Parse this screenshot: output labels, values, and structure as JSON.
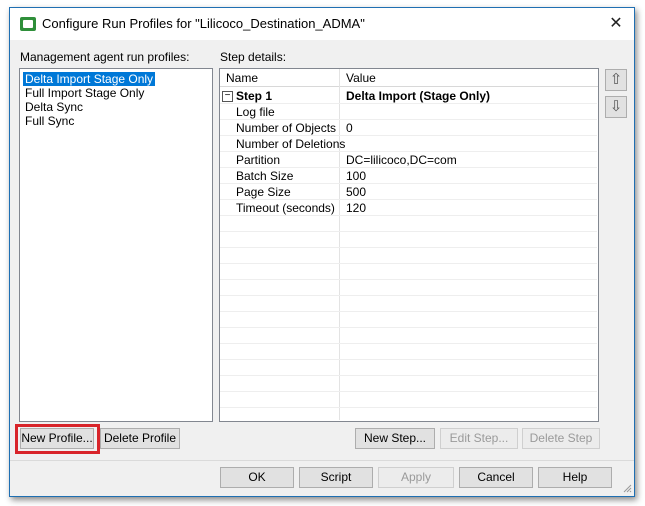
{
  "window": {
    "title": "Configure Run Profiles for \"Lilicoco_Destination_ADMA\"",
    "close_glyph": "✕"
  },
  "profiles": {
    "label": "Management agent run profiles:",
    "items": [
      {
        "label": "Delta Import Stage Only",
        "selected": true
      },
      {
        "label": "Full Import Stage Only",
        "selected": false
      },
      {
        "label": "Delta Sync",
        "selected": false
      },
      {
        "label": "Full Sync",
        "selected": false
      }
    ],
    "new_button": "New Profile...",
    "delete_button": "Delete Profile"
  },
  "step_details": {
    "label": "Step details:",
    "columns": [
      "Name",
      "Value"
    ],
    "collapse_glyph": "−",
    "step": {
      "name": "Step 1",
      "value": "Delta Import (Stage Only)"
    },
    "rows": [
      {
        "name": "Log file",
        "value": ""
      },
      {
        "name": "Number of Objects",
        "value": "0"
      },
      {
        "name": "Number of Deletions",
        "value": ""
      },
      {
        "name": "Partition",
        "value": "DC=lilicoco,DC=com"
      },
      {
        "name": "Batch Size",
        "value": "100"
      },
      {
        "name": "Page Size",
        "value": "500"
      },
      {
        "name": "Timeout (seconds)",
        "value": "120"
      }
    ],
    "up_glyph": "⇧",
    "down_glyph": "⇩",
    "new_step_button": "New Step...",
    "edit_step_button": "Edit Step...",
    "delete_step_button": "Delete Step"
  },
  "footer": {
    "ok": "OK",
    "script": "Script",
    "apply": "Apply",
    "cancel": "Cancel",
    "help": "Help"
  },
  "colors": {
    "selection": "#0078d7",
    "highlight": "#d8242a",
    "window_border": "#1f6fb2"
  }
}
